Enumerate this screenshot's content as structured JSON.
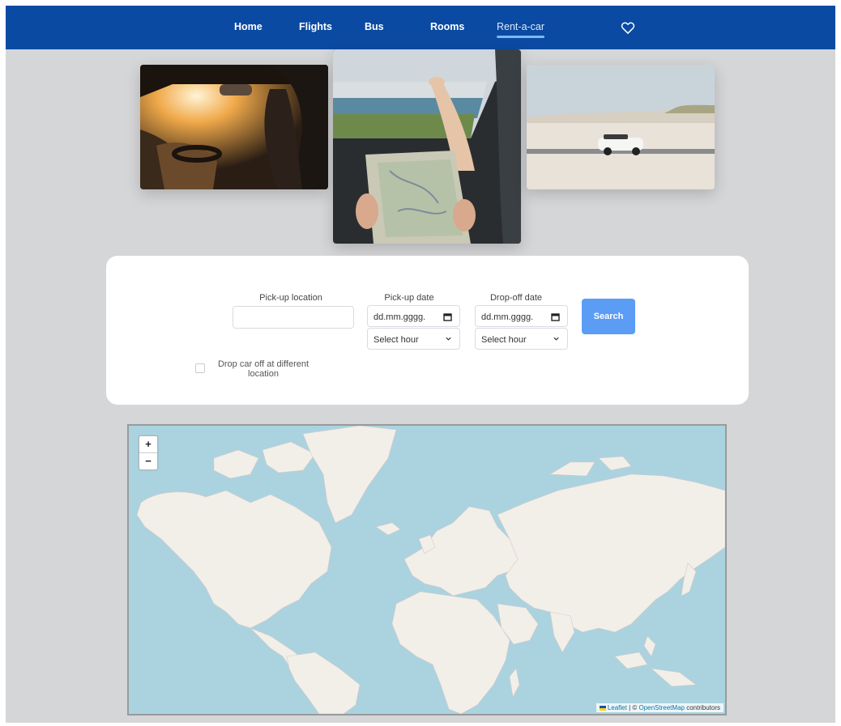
{
  "nav": {
    "items": [
      {
        "label": "Home"
      },
      {
        "label": "Flights"
      },
      {
        "label": "Bus"
      },
      {
        "label": "Rooms"
      },
      {
        "label": "Rent-a-car",
        "active": true
      }
    ],
    "favorites_icon": "heart-icon",
    "bg_color": "#0a4aa2",
    "active_underline_color": "#7ab8ff"
  },
  "photos": [
    {
      "subject": "driver-in-car-sunlight"
    },
    {
      "subject": "map-reading-feet-on-dashboard"
    },
    {
      "subject": "white-convertible-on-beach-road"
    }
  ],
  "search": {
    "pickup_location": {
      "label": "Pick-up location",
      "value": ""
    },
    "pickup_date": {
      "label": "Pick-up date",
      "value": "dd.mm.gggg.",
      "icon": "calendar-icon",
      "hour": "Select hour"
    },
    "dropoff_date": {
      "label": "Drop-off date",
      "value": "dd.mm.gggg.",
      "icon": "calendar-icon",
      "hour": "Select hour"
    },
    "search_label": "Search",
    "different_location_label": "Drop car off at different location",
    "different_location_checked": false,
    "button_color": "#5b9cf5"
  },
  "map": {
    "zoom_in": "+",
    "zoom_out": "−",
    "attribution": {
      "leaflet": "Leaflet",
      "separator": " | © ",
      "osm": "OpenStreetMap",
      "suffix": " contributors"
    },
    "water_color": "#aad3df",
    "land_color": "#f2efe9"
  }
}
